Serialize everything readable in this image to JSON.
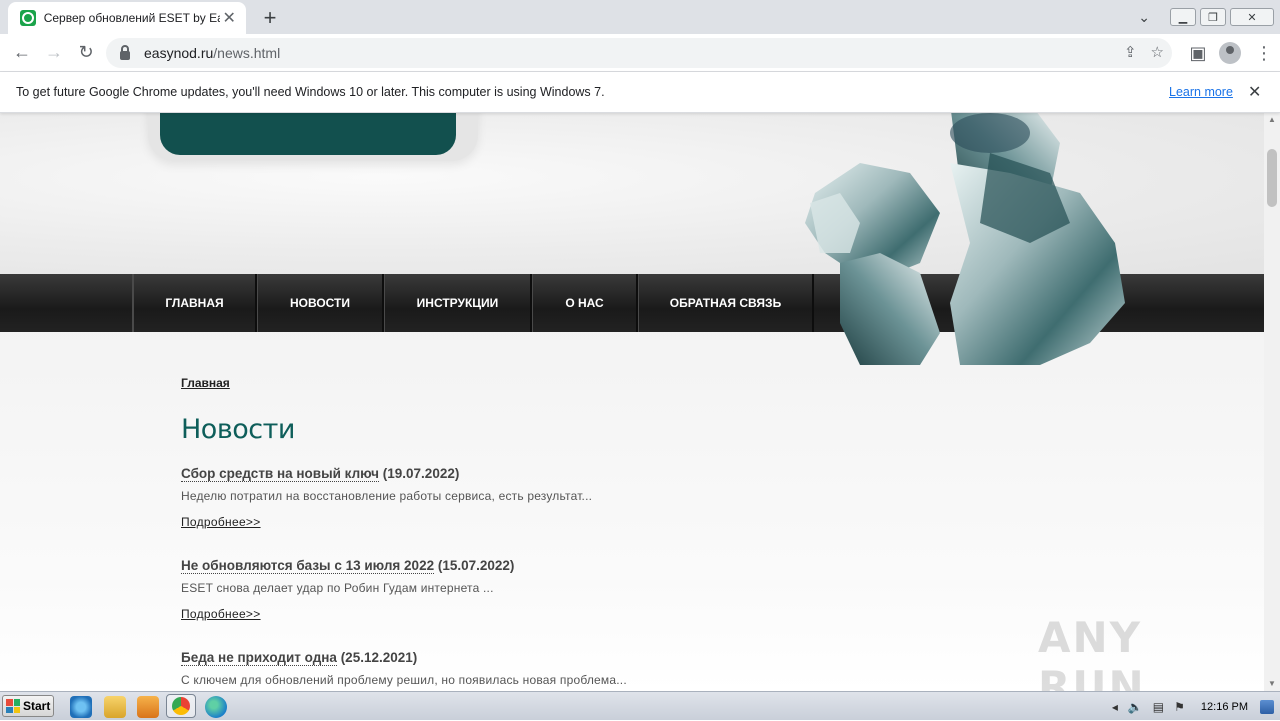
{
  "browser": {
    "tab_title": "Сервер обновлений ESET by EasyN",
    "url_host": "easynod.ru",
    "url_path": "/news.html"
  },
  "infobar": {
    "message": "To get future Google Chrome updates, you'll need Windows 10 or later. This computer is using Windows 7.",
    "link": "Learn more"
  },
  "nav": {
    "items": [
      "ГЛАВНАЯ",
      "НОВОСТИ",
      "ИНСТРУКЦИИ",
      "О НАС",
      "ОБРАТНАЯ СВЯЗЬ"
    ]
  },
  "page": {
    "breadcrumb": "Главная",
    "title": "Новости",
    "more_label": "Подробнее>>",
    "news": [
      {
        "title": "Сбор средств на новый ключ",
        "date": " (19.07.2022)",
        "desc": "Неделю потратил на восстановление работы сервиса, есть результат..."
      },
      {
        "title": "Не обновляются базы с 13 июля 2022",
        "date": " (15.07.2022)",
        "desc": "ESET снова делает удар по Робин Гудам интернета ..."
      },
      {
        "title": "Беда не приходит одна",
        "date": " (25.12.2021)",
        "desc": "С ключем для обновлений проблему решил, но появилась новая проблема..."
      }
    ]
  },
  "watermark": "ANY RUN",
  "taskbar": {
    "start_label": "Start",
    "clock": "12:16 PM"
  },
  "colors": {
    "accent": "#0e5e5a",
    "navbar": "#1a1a1a",
    "link": "#1a73e8"
  }
}
